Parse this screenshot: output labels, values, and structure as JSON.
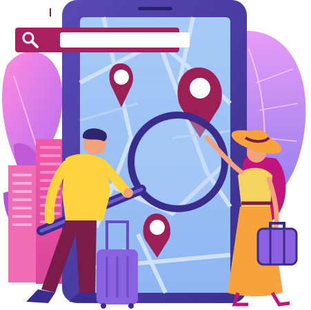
{
  "search": {
    "value": "",
    "icon": "search-icon"
  },
  "colors": {
    "phone_frame": "#4a3aa3",
    "map_screen": "#9fc4f5",
    "map_roads": "#cfe1fb",
    "pin_fill": "#9c1f55",
    "pin_center": "#ffffff",
    "accent_magenta": "#a8205f",
    "leaf_pink": "#ff7fd0",
    "building_pink": "#ef4fa7",
    "luggage_purple": "#7d53d6",
    "man_shirt": "#ffd33f",
    "woman_dress": "#f4d35e",
    "skirt_orange": "#f7a33d",
    "hair_magenta": "#c2147a"
  },
  "icons": [
    "search-icon",
    "location-pin-icon",
    "magnifying-glass-icon",
    "suitcase-icon",
    "rolling-luggage-icon",
    "sun-hat-icon"
  ]
}
